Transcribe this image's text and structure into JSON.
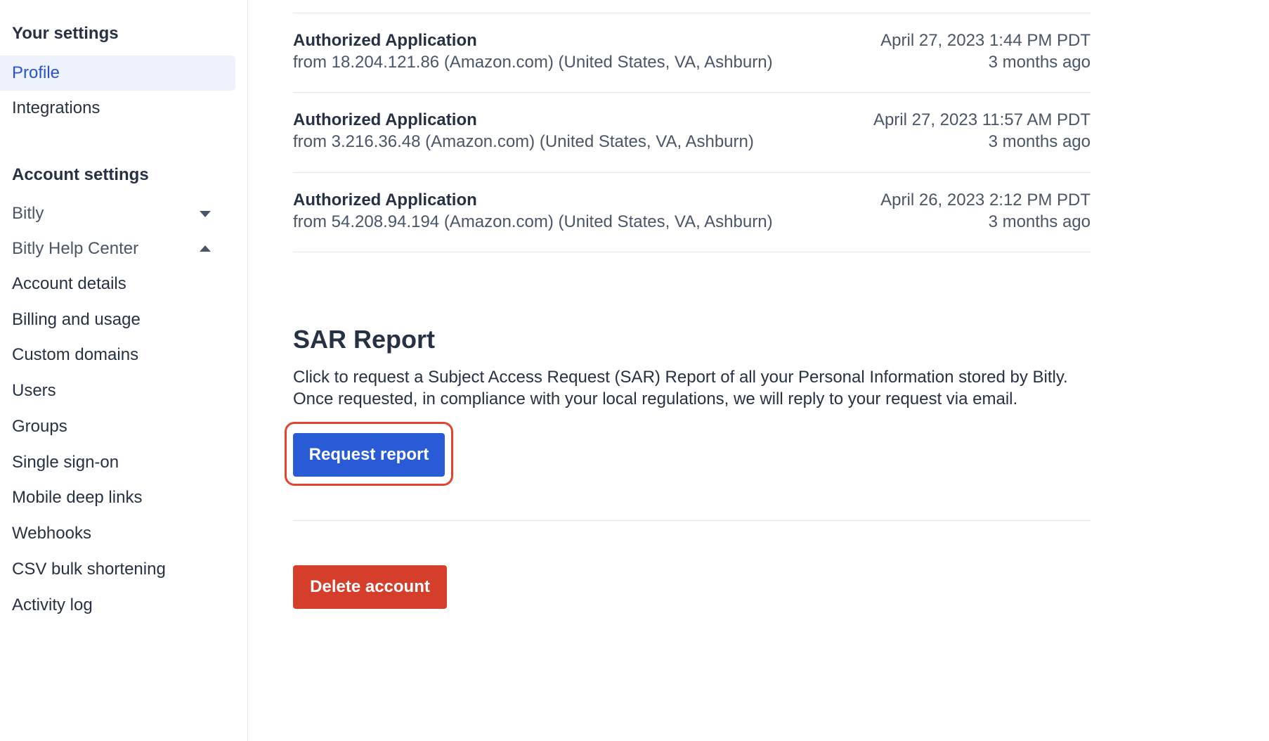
{
  "sidebar": {
    "your_settings_heading": "Your settings",
    "your_settings_items": [
      {
        "label": "Profile",
        "active": true
      },
      {
        "label": "Integrations",
        "active": false
      }
    ],
    "account_settings_heading": "Account settings",
    "groups": [
      {
        "label": "Bitly",
        "expanded": false
      },
      {
        "label": "Bitly Help Center",
        "expanded": true
      }
    ],
    "account_items": [
      "Account details",
      "Billing and usage",
      "Custom domains",
      "Users",
      "Groups",
      "Single sign-on",
      "Mobile deep links",
      "Webhooks",
      "CSV bulk shortening",
      "Activity log"
    ]
  },
  "sessions": [
    {
      "title": "Authorized Application",
      "from": "from 18.204.121.86 (Amazon.com) (United States, VA, Ashburn)",
      "date": "April 27, 2023 1:44 PM PDT",
      "ago": "3 months ago"
    },
    {
      "title": "Authorized Application",
      "from": "from 3.216.36.48 (Amazon.com) (United States, VA, Ashburn)",
      "date": "April 27, 2023 11:57 AM PDT",
      "ago": "3 months ago"
    },
    {
      "title": "Authorized Application",
      "from": "from 54.208.94.194 (Amazon.com) (United States, VA, Ashburn)",
      "date": "April 26, 2023 2:12 PM PDT",
      "ago": "3 months ago"
    }
  ],
  "sar": {
    "title": "SAR Report",
    "description": "Click to request a Subject Access Request (SAR) Report of all your Personal Information stored by Bitly. Once requested, in compliance with your local regulations, we will reply to your request via email.",
    "button_label": "Request report"
  },
  "delete_account": {
    "button_label": "Delete account"
  },
  "colors": {
    "primary": "#2a5bd7",
    "danger": "#d43e2a",
    "highlight": "#e3442f",
    "active_bg": "#eef2fd",
    "active_text": "#2a52cf"
  }
}
